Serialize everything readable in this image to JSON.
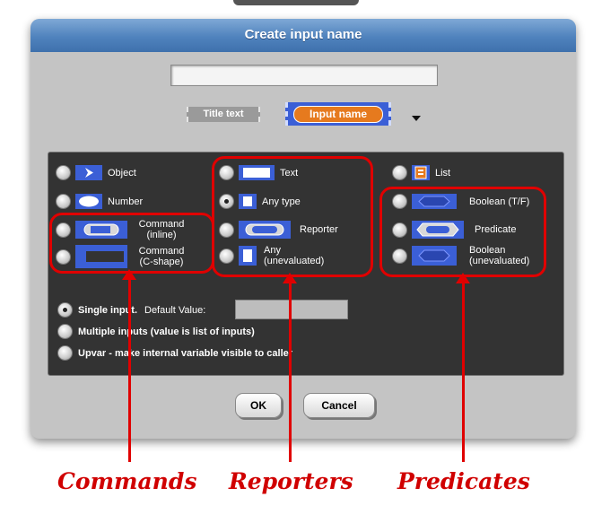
{
  "dialog": {
    "title": "Create input name"
  },
  "name_field": {
    "value": ""
  },
  "title_text_label": "Title text",
  "input_name_label": "Input name",
  "types": {
    "object": "Object",
    "number": "Number",
    "command_inline": [
      "Command",
      "(inline)"
    ],
    "command_c": [
      "Command",
      "(C-shape)"
    ],
    "text": "Text",
    "any_type": "Any type",
    "reporter": "Reporter",
    "any_unevaluated": [
      "Any",
      "(unevaluated)"
    ],
    "list": "List",
    "boolean": "Boolean (T/F)",
    "predicate": "Predicate",
    "boolean_unevaluated": [
      "Boolean",
      "(unevaluated)"
    ],
    "selected": "Any type"
  },
  "arity": {
    "single": "Single input.",
    "default_value_label": "Default Value:",
    "default_value": "",
    "multiple": "Multiple inputs (value is list of inputs)",
    "upvar": "Upvar - make internal variable visible to caller",
    "selected": "Single input."
  },
  "buttons": {
    "ok": "OK",
    "cancel": "Cancel"
  },
  "annotations": {
    "commands": "Commands",
    "reporters": "Reporters",
    "predicates": "Predicates",
    "color": "#e00000"
  },
  "colors": {
    "title_bar": "#4f82bd",
    "block_blue": "#3b5fd6",
    "input_orange": "#e67a1e",
    "panel": "#333333"
  }
}
